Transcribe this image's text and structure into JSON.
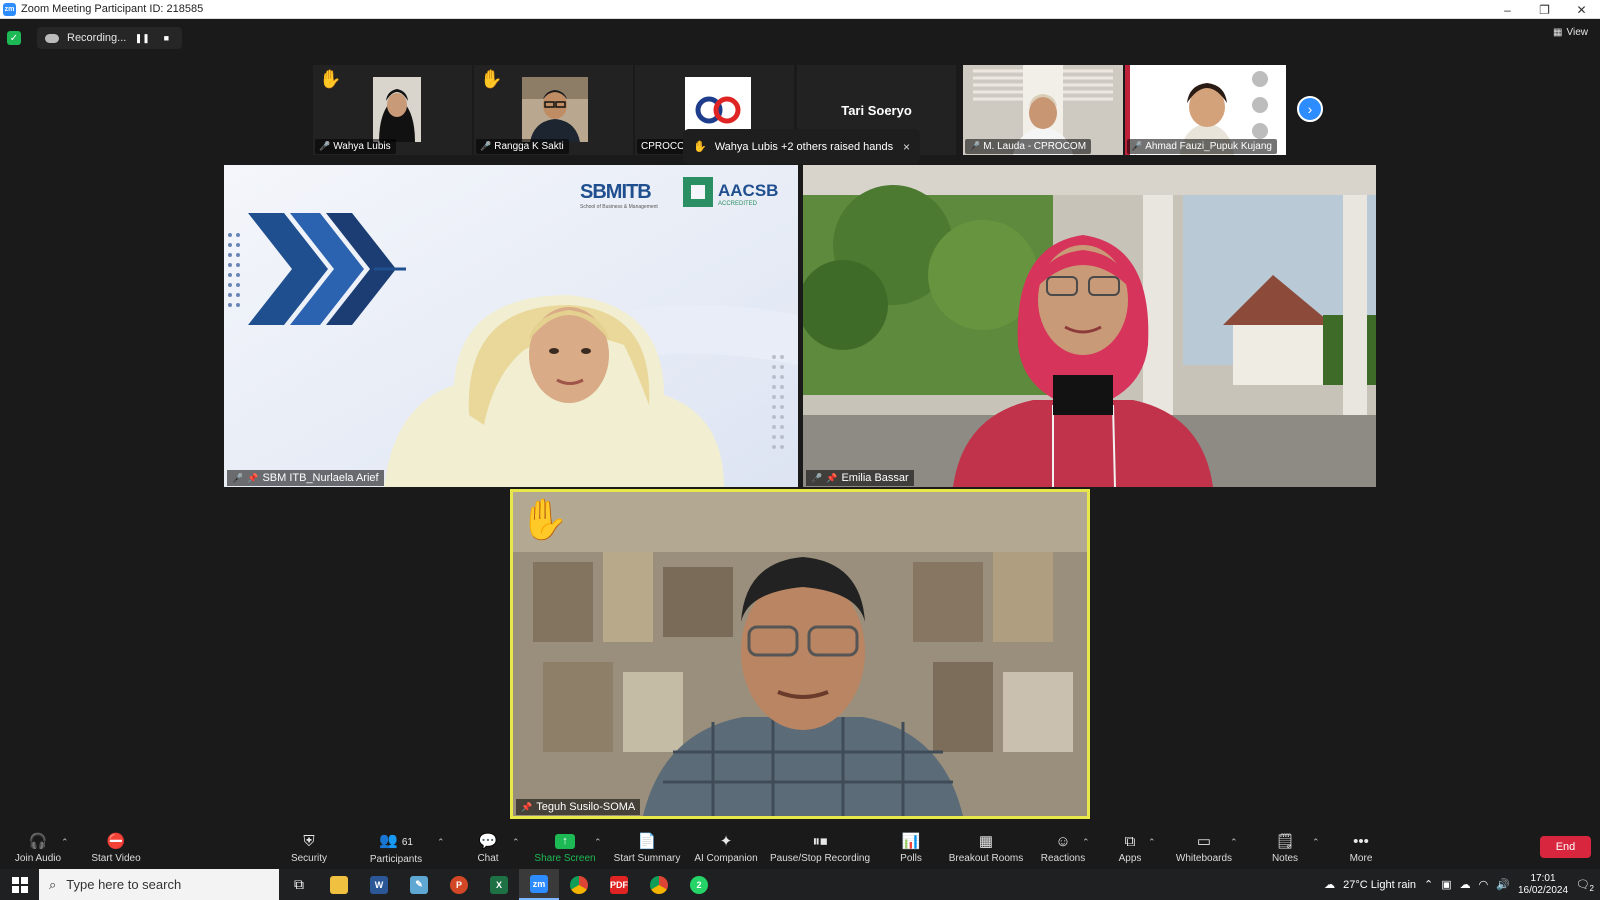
{
  "window": {
    "title": "Zoom Meeting Participant ID: 218585",
    "app_badge": "zm",
    "minimize": "–",
    "restore": "❐",
    "close": "✕"
  },
  "recording": {
    "label": "Recording...",
    "pause": "❚❚",
    "stop": "■"
  },
  "view_label": "View",
  "strip": [
    {
      "name": "Wahya Lubis",
      "raised_hand": true,
      "muted": true
    },
    {
      "name": "Rangga K Sakti",
      "raised_hand": true,
      "muted": true
    },
    {
      "name": "CPROCOM",
      "raised_hand": false,
      "muted": false
    },
    {
      "name": "Tari Soeryo",
      "raised_hand": false,
      "muted": false
    },
    {
      "name": "M. Lauda - CPROCOM",
      "raised_hand": false,
      "muted": true
    },
    {
      "name": "Ahmad Fauzi_Pupuk Kujang",
      "raised_hand": false,
      "muted": true
    }
  ],
  "toast": {
    "text": "Wahya Lubis +2 others raised hands",
    "close": "×"
  },
  "tiles": {
    "left_name": "SBM ITB_Nurlaela Arief",
    "right_name": "Emilia Bassar",
    "bottom_name": "Teguh Susilo-SOMA",
    "logo_sbm": "SBMITB",
    "logo_sbm_sub": "School of Business & Management",
    "logo_aacsb": "AACSB",
    "logo_aacsb_sub": "ACCREDITED"
  },
  "toolbar": {
    "join_audio": "Join Audio",
    "start_video": "Start Video",
    "security": "Security",
    "participants": "Participants",
    "participants_count": "61",
    "chat": "Chat",
    "share_screen": "Share Screen",
    "start_summary": "Start Summary",
    "ai_companion": "AI Companion",
    "pause_stop_recording": "Pause/Stop Recording",
    "polls": "Polls",
    "breakout_rooms": "Breakout Rooms",
    "reactions": "Reactions",
    "apps": "Apps",
    "whiteboards": "Whiteboards",
    "notes": "Notes",
    "more": "More",
    "end": "End"
  },
  "taskbar": {
    "search_placeholder": "Type here to search",
    "weather": "27°C  Light rain",
    "time": "17:01",
    "date": "16/02/2024",
    "notification_count": "2",
    "zoom_badge": "zm",
    "whatsapp_badge": "2"
  },
  "colors": {
    "active_speaker_border": "#e8e84a",
    "accent_blue": "#2d8cff",
    "end_red": "#d7263d",
    "share_green": "#1db954"
  }
}
